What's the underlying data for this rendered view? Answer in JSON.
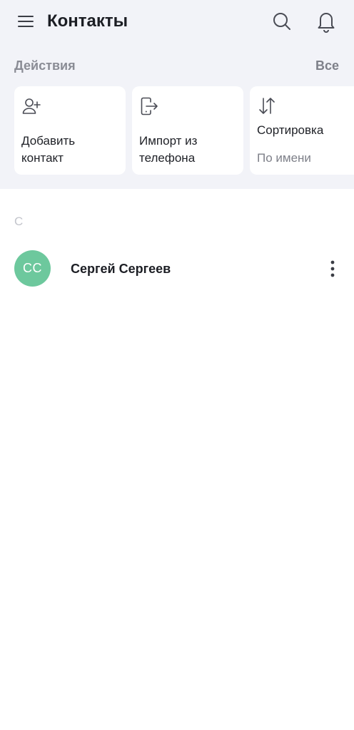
{
  "header": {
    "title": "Контакты",
    "menu_icon": "hamburger-menu-icon",
    "search_icon": "search-icon",
    "bell_icon": "bell-icon"
  },
  "actions": {
    "title": "Действия",
    "all_label": "Все",
    "cards": [
      {
        "label": "Добавить\nконтакт",
        "icon": "add-user-icon"
      },
      {
        "label": "Импорт из\nтелефона",
        "icon": "phone-import-icon"
      },
      {
        "label": "Сортировка",
        "sublabel": "По имени",
        "icon": "sort-arrows-icon"
      }
    ]
  },
  "contacts": {
    "section_letter": "С",
    "items": [
      {
        "initials": "СС",
        "name": "Сергей Сергеев",
        "avatar_color": "#6dc89d"
      }
    ]
  },
  "colors": {
    "top_background": "#f2f3f8",
    "accent_green": "#6dc89d",
    "text_primary": "#1c1e24",
    "text_secondary": "#7e8089"
  }
}
